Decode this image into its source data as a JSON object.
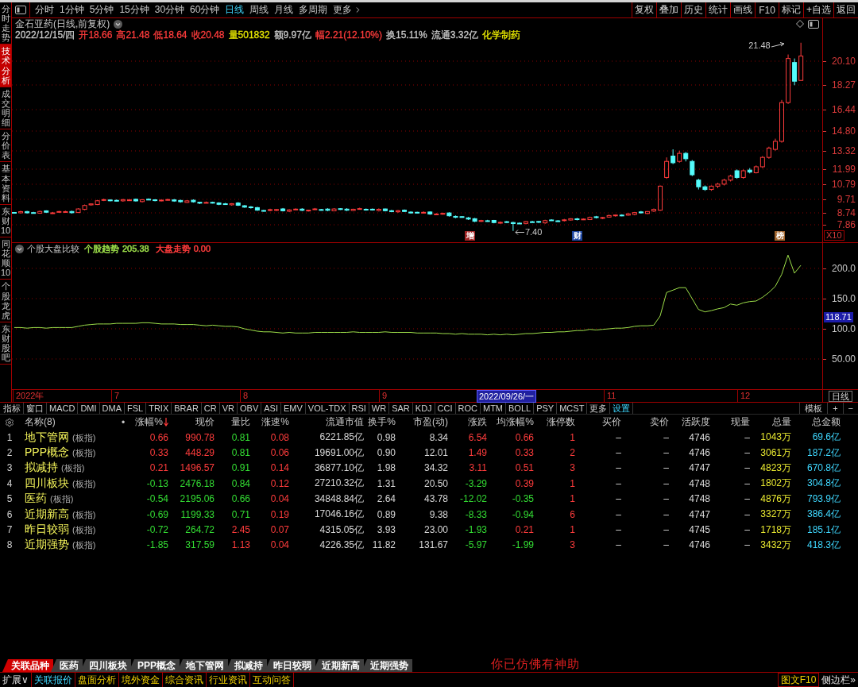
{
  "toolbar": {
    "periods": [
      {
        "label": "分时",
        "kind": "period",
        "selected": false
      },
      {
        "label": "1分钟",
        "kind": "period",
        "selected": false
      },
      {
        "label": "5分钟",
        "kind": "period",
        "selected": false
      },
      {
        "label": "15分钟",
        "kind": "period",
        "selected": false
      },
      {
        "label": "30分钟",
        "kind": "period",
        "selected": false
      },
      {
        "label": "60分钟",
        "kind": "period",
        "selected": false
      },
      {
        "label": "日线",
        "kind": "period",
        "selected": true
      },
      {
        "label": "周线",
        "kind": "period",
        "selected": false
      },
      {
        "label": "月线",
        "kind": "period",
        "selected": false
      },
      {
        "label": "多周期",
        "kind": "period",
        "selected": false
      },
      {
        "label": "更多",
        "kind": "menu",
        "selected": false
      }
    ],
    "actions": [
      "复权",
      "叠加",
      "历史",
      "统计",
      "画线",
      "F10",
      "标记",
      "+自选",
      "返回"
    ]
  },
  "sidebar": {
    "items": [
      {
        "label": "分时走势",
        "selected": false
      },
      {
        "label": "技术分析",
        "selected": true
      },
      {
        "label": "成交明细",
        "selected": false
      },
      {
        "label": "分价表",
        "selected": false
      },
      {
        "label": "基本资料",
        "selected": false
      },
      {
        "label": "东财10",
        "selected": false
      },
      {
        "label": "同花顺10",
        "selected": false
      },
      {
        "label": "个股龙虎",
        "selected": false
      },
      {
        "label": "东财股吧",
        "selected": false
      }
    ]
  },
  "quote": {
    "title": "金石亚药(日线,前复权)",
    "fields": [
      {
        "text": "2022/12/15/四",
        "color": "#c8c8c8"
      },
      {
        "text": "开18.66",
        "color": "#ff3c3c"
      },
      {
        "text": "高21.48",
        "color": "#ff3c3c"
      },
      {
        "text": "低18.64",
        "color": "#ff3c3c"
      },
      {
        "text": "收20.48",
        "color": "#ff3c3c"
      },
      {
        "text": "量501832",
        "color": "#e6e600"
      },
      {
        "text": "额9.97亿",
        "color": "#c8c8c8"
      },
      {
        "text": "幅2.21(12.10%)",
        "color": "#ff3c3c"
      },
      {
        "text": "换15.11%",
        "color": "#c8c8c8"
      },
      {
        "text": "流通3.32亿",
        "color": "#c8c8c8"
      },
      {
        "text": "化学制药",
        "color": "#e6e600"
      }
    ]
  },
  "kline": {
    "price_ticks": [
      "20.10",
      "18.27",
      "16.44",
      "14.80",
      "13.32",
      "11.99",
      "10.79",
      "9.71",
      "8.74",
      "7.86"
    ],
    "high_label": "21.48",
    "low_label": "7.40",
    "events": [
      {
        "label": "增",
        "color": "#a02323"
      },
      {
        "label": "财",
        "color": "#1e46a0"
      },
      {
        "label": "榜",
        "color": "#a0642d"
      }
    ],
    "scale_button": "X10"
  },
  "indicator": {
    "title": "个股大盘比较",
    "legend": [
      {
        "value": "205.38"
      },
      {
        "name": "大盘走势",
        "value": "0.00",
        "color": "#ff3c3c"
      }
    ],
    "current_value": "118.71",
    "chart_data": {
      "type": "line",
      "grid": true,
      "ylim": [
        -21,
        614
      ],
      "yticks": [
        {
          "value": 50,
          "label": "50.00"
        },
        {
          "value": 100,
          "label": "100.0"
        },
        {
          "value": 150,
          "label": "150.0"
        },
        {
          "value": 200,
          "label": "200.0"
        }
      ],
      "series": [
        {
          "name": "个股趋势",
          "color": "#9ee04a",
          "values": [
            102,
            102,
            101,
            102,
            102,
            101,
            102,
            102,
            102,
            102,
            104,
            106,
            107,
            108,
            108,
            108,
            109,
            109,
            109,
            109,
            110,
            110,
            109,
            108,
            108,
            108,
            107,
            107,
            107,
            106,
            105,
            106,
            105,
            104,
            104,
            103,
            100,
            98,
            96,
            95,
            95,
            94,
            93,
            94,
            93,
            93,
            93,
            94,
            94,
            94,
            94,
            94,
            94,
            95,
            94,
            94,
            94,
            94,
            95,
            94,
            94,
            94,
            94,
            93,
            93,
            93,
            93,
            92,
            92,
            91,
            92,
            91,
            91,
            91,
            90,
            91,
            90,
            91,
            90,
            91,
            92,
            92,
            93,
            94,
            94,
            95,
            95,
            96,
            97,
            97,
            99,
            98,
            99,
            100,
            101,
            101,
            102,
            104,
            105,
            105,
            106,
            121,
            160,
            164,
            168,
            168,
            150,
            132,
            128,
            130,
            133,
            135,
            141,
            139,
            143,
            145,
            146,
            152,
            160,
            170,
            190,
            222,
            192,
            205
          ]
        }
      ]
    }
  },
  "date_axis": {
    "labels": [
      {
        "text": "2022年",
        "kind": "month"
      },
      {
        "text": "7",
        "kind": "month"
      },
      {
        "text": "8",
        "kind": "month"
      },
      {
        "text": "9",
        "kind": "month"
      },
      {
        "text": "2022/09/26/一",
        "kind": "cursor"
      },
      {
        "text": "11",
        "kind": "month"
      },
      {
        "text": "12",
        "kind": "month"
      }
    ],
    "period_button": "日线"
  },
  "indicator_tabs": {
    "items": [
      {
        "label": "指标",
        "kind": "plain"
      },
      {
        "label": "窗口",
        "kind": "plain"
      },
      {
        "label": "MACD",
        "kind": "plain"
      },
      {
        "label": "DMI",
        "kind": "plain"
      },
      {
        "label": "DMA",
        "kind": "plain"
      },
      {
        "label": "FSL",
        "kind": "plain"
      },
      {
        "label": "TRIX",
        "kind": "plain"
      },
      {
        "label": "BRAR",
        "kind": "plain"
      },
      {
        "label": "CR",
        "kind": "plain"
      },
      {
        "label": "VR",
        "kind": "plain"
      },
      {
        "label": "OBV",
        "kind": "plain"
      },
      {
        "label": "ASI",
        "kind": "plain"
      },
      {
        "label": "EMV",
        "kind": "plain"
      },
      {
        "label": "VOL-TDX",
        "kind": "plain"
      },
      {
        "label": "RSI",
        "kind": "plain"
      },
      {
        "label": "WR",
        "kind": "plain"
      },
      {
        "label": "SAR",
        "kind": "plain"
      },
      {
        "label": "KDJ",
        "kind": "plain"
      },
      {
        "label": "CCI",
        "kind": "plain"
      },
      {
        "label": "ROC",
        "kind": "plain"
      },
      {
        "label": "MTM",
        "kind": "plain"
      },
      {
        "label": "BOLL",
        "kind": "plain"
      },
      {
        "label": "PSY",
        "kind": "plain"
      },
      {
        "label": "MCST",
        "kind": "plain"
      },
      {
        "label": "更多",
        "kind": "plain"
      },
      {
        "label": "设置",
        "kind": "accent"
      }
    ],
    "tools": [
      "模板",
      "+",
      "−"
    ]
  },
  "table": {
    "columns": [
      {
        "kind": "index"
      },
      {
        "label": "名称(8)",
        "kind": "name"
      },
      {
        "label": "•",
        "kind": "marker"
      },
      {
        "label": "涨幅%",
        "kind": "trend",
        "sorted": true
      },
      {
        "label": "现价",
        "kind": "trend"
      },
      {
        "label": "量比",
        "kind": "trend"
      },
      {
        "label": "涨速%",
        "kind": "trend"
      },
      {
        "label": "流通市值",
        "kind": "plain"
      },
      {
        "label": "换手%",
        "kind": "plain"
      },
      {
        "label": "市盈(动)",
        "kind": "plain"
      },
      {
        "label": "涨跌",
        "kind": "trend"
      },
      {
        "label": "均涨幅%",
        "kind": "trend"
      },
      {
        "label": "涨停数",
        "kind": "limit"
      },
      {
        "label": "买价",
        "kind": "plain"
      },
      {
        "label": "卖价",
        "kind": "plain"
      },
      {
        "label": "活跃度",
        "kind": "plain"
      },
      {
        "label": "现量",
        "kind": "plain"
      },
      {
        "label": "总量",
        "kind": "volume"
      },
      {
        "label": "总金额",
        "kind": "amount"
      }
    ],
    "rows": [
      {
        "cells": [
          "1",
          {
            "text": "地下管网",
            "tag": "(板指)"
          },
          "",
          {
            "text": "0.66",
            "up": true
          },
          {
            "text": "990.78",
            "up": true
          },
          {
            "text": "0.81",
            "up": false
          },
          {
            "text": "0.08",
            "up": true
          },
          "6221.85亿",
          "0.98",
          "8.34",
          {
            "text": "6.54",
            "up": true
          },
          {
            "text": "0.66",
            "up": true
          },
          "1",
          "–",
          "–",
          "4746",
          "–",
          "1043万",
          "69.6亿"
        ]
      },
      {
        "cells": [
          "2",
          {
            "text": "PPP概念",
            "tag": "(板指)"
          },
          "",
          {
            "text": "0.33",
            "up": true
          },
          {
            "text": "448.29",
            "up": true
          },
          {
            "text": "0.81",
            "up": false
          },
          {
            "text": "0.06",
            "up": true
          },
          "19691.00亿",
          "0.90",
          "12.01",
          {
            "text": "1.49",
            "up": true
          },
          {
            "text": "0.33",
            "up": true
          },
          "2",
          "–",
          "–",
          "4746",
          "–",
          "3061万",
          "187.2亿"
        ]
      },
      {
        "cells": [
          "3",
          {
            "text": "拟减持",
            "tag": "(板指)"
          },
          "",
          {
            "text": "0.21",
            "up": true
          },
          {
            "text": "1496.57",
            "up": true
          },
          {
            "text": "0.91",
            "up": false
          },
          {
            "text": "0.14",
            "up": true
          },
          "36877.10亿",
          "1.98",
          "34.32",
          {
            "text": "3.11",
            "up": true
          },
          {
            "text": "0.51",
            "up": true
          },
          "3",
          "–",
          "–",
          "4747",
          "–",
          "4823万",
          "670.8亿"
        ]
      },
      {
        "cells": [
          "4",
          {
            "text": "四川板块",
            "tag": "(板指)"
          },
          "",
          {
            "text": "-0.13",
            "up": false
          },
          {
            "text": "2476.18",
            "up": false
          },
          {
            "text": "0.84",
            "up": false
          },
          {
            "text": "0.12",
            "up": true
          },
          "27210.32亿",
          "1.31",
          "20.50",
          {
            "text": "-3.29",
            "up": false
          },
          {
            "text": "0.39",
            "up": true
          },
          "1",
          "–",
          "–",
          "4748",
          "–",
          "1802万",
          "304.8亿"
        ]
      },
      {
        "cells": [
          "5",
          {
            "text": "医药",
            "tag": "(板指)"
          },
          "",
          {
            "text": "-0.54",
            "up": false
          },
          {
            "text": "2195.06",
            "up": false
          },
          {
            "text": "0.66",
            "up": false
          },
          {
            "text": "0.04",
            "up": true
          },
          "34848.84亿",
          "2.64",
          "43.78",
          {
            "text": "-12.02",
            "up": false
          },
          {
            "text": "-0.35",
            "up": false
          },
          "1",
          "–",
          "–",
          "4748",
          "–",
          "4876万",
          "793.9亿"
        ]
      },
      {
        "cells": [
          "6",
          {
            "text": "近期新高",
            "tag": "(板指)"
          },
          "",
          {
            "text": "-0.69",
            "up": false
          },
          {
            "text": "1199.33",
            "up": false
          },
          {
            "text": "0.71",
            "up": false
          },
          {
            "text": "0.19",
            "up": true
          },
          "17046.16亿",
          "0.89",
          "9.38",
          {
            "text": "-8.33",
            "up": false
          },
          {
            "text": "-0.94",
            "up": false
          },
          "6",
          "–",
          "–",
          "4747",
          "–",
          "3327万",
          "386.4亿"
        ]
      },
      {
        "cells": [
          "7",
          {
            "text": "昨日较弱",
            "tag": "(板指)"
          },
          "",
          {
            "text": "-0.72",
            "up": false
          },
          {
            "text": "264.72",
            "up": false
          },
          {
            "text": "2.45",
            "up": true
          },
          {
            "text": "0.07",
            "up": true
          },
          "4315.05亿",
          "3.93",
          "23.00",
          {
            "text": "-1.93",
            "up": false
          },
          {
            "text": "0.21",
            "up": true
          },
          "1",
          "–",
          "–",
          "4745",
          "–",
          "1718万",
          "185.1亿"
        ]
      },
      {
        "cells": [
          "8",
          {
            "text": "近期强势",
            "tag": "(板指)"
          },
          "",
          {
            "text": "-1.85",
            "up": false
          },
          {
            "text": "317.59",
            "up": false
          },
          {
            "text": "1.13",
            "up": true
          },
          {
            "text": "0.04",
            "up": true
          },
          "4226.35亿",
          "11.82",
          "131.67",
          {
            "text": "-5.97",
            "up": false
          },
          {
            "text": "-1.99",
            "up": false
          },
          "3",
          "–",
          "–",
          "4746",
          "–",
          "3432万",
          "418.3亿"
        ]
      }
    ]
  },
  "bottom_tabs": {
    "items": [
      {
        "label": "关联品种",
        "selected": true
      },
      {
        "label": "医药",
        "selected": false
      },
      {
        "label": "四川板块",
        "selected": false
      },
      {
        "label": "PPP概念",
        "selected": false
      },
      {
        "label": "地下管网",
        "selected": false
      },
      {
        "label": "拟减持",
        "selected": false
      },
      {
        "label": "昨日较弱",
        "selected": false
      },
      {
        "label": "近期新高",
        "selected": false
      },
      {
        "label": "近期强势",
        "selected": false
      }
    ],
    "ticker": "你已仿佛有神助"
  },
  "status_bar": {
    "items": [
      {
        "label": "扩展∨",
        "kind": "menu",
        "selected": false
      },
      {
        "label": "关联报价",
        "kind": "tab",
        "selected": true
      },
      {
        "label": "盘面分析",
        "kind": "tab",
        "selected": false
      },
      {
        "label": "境外资金",
        "kind": "tab",
        "selected": false
      },
      {
        "label": "综合资讯",
        "kind": "tab",
        "selected": false
      },
      {
        "label": "行业资讯",
        "kind": "tab",
        "selected": false
      },
      {
        "label": "互动问答",
        "kind": "tab",
        "selected": false
      }
    ],
    "right_items": [
      {
        "label": "图文F10",
        "kind": "boxed"
      },
      {
        "label": "侧边栏»",
        "kind": "plain"
      }
    ]
  }
}
